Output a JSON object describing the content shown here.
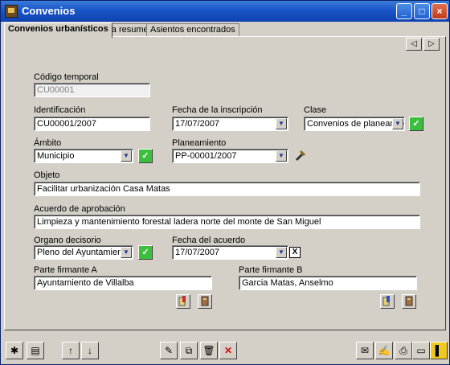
{
  "window": {
    "title": "Convenios"
  },
  "titlebar_buttons": {
    "minimize": "_",
    "maximize": "□",
    "close": "×"
  },
  "tabs": [
    {
      "label": "Convenios urbanísticos"
    },
    {
      "label": "Ficha resumen"
    },
    {
      "label": "Asientos encontrados"
    }
  ],
  "nav": {
    "prev": "◁",
    "next": "▷"
  },
  "form": {
    "codigo_temporal": {
      "label": "Código temporal",
      "value": "CU00001"
    },
    "identificacion": {
      "label": "Identificación",
      "value": "CU00001/2007"
    },
    "fecha_inscripcion": {
      "label": "Fecha de la inscripción",
      "value": "17/07/2007"
    },
    "clase": {
      "label": "Clase",
      "value": "Convenios  de planeamie"
    },
    "ambito": {
      "label": "Ámbito",
      "value": "Municipio"
    },
    "planeamiento": {
      "label": "Planeamiento",
      "value": "PP-00001/2007"
    },
    "objeto": {
      "label": "Objeto",
      "value": "Facilitar urbanización Casa Matas"
    },
    "acuerdo_aprobacion": {
      "label": "Acuerdo de aprobación",
      "value": "Limpieza y mantenimiento forestal ladera norte del monte de San Miguel"
    },
    "organo_decisorio": {
      "label": "Organo decisorio",
      "value": "Pleno del Ayuntamiento"
    },
    "fecha_acuerdo": {
      "label": "Fecha del acuerdo",
      "value": "17/07/2007"
    },
    "parte_a": {
      "label": "Parte firmante A",
      "value": "Ayuntamiento de Villalba"
    },
    "parte_b": {
      "label": "Parte firmante B",
      "value": "Garcia Matas, Anselmo"
    }
  },
  "glyphs": {
    "dropdown": "▼",
    "check": "✓",
    "clear": "X"
  }
}
